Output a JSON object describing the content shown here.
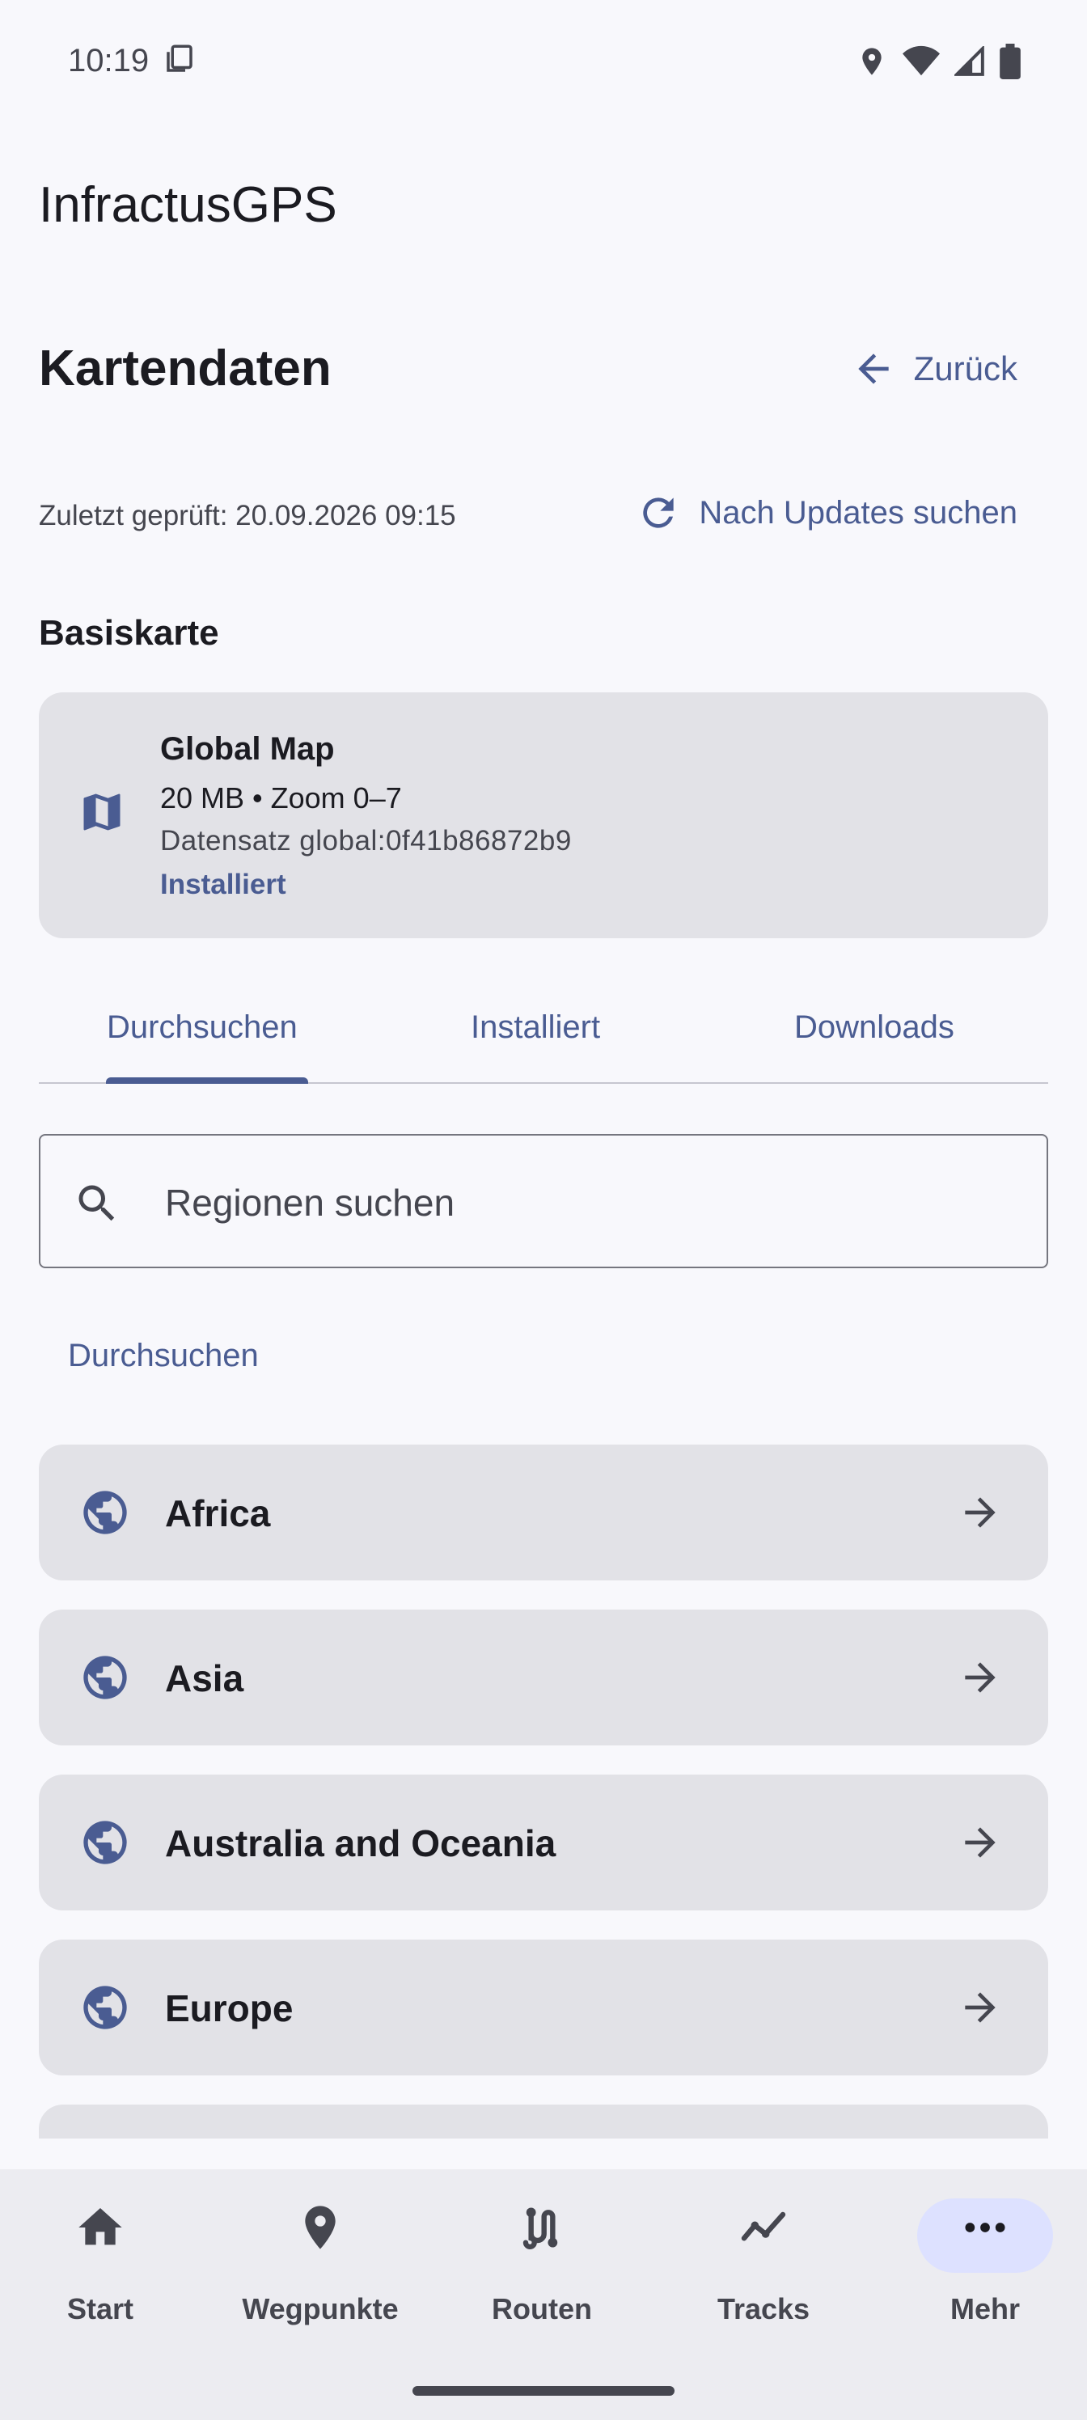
{
  "status_bar": {
    "time": "10:19"
  },
  "app": {
    "title": "InfractusGPS"
  },
  "header": {
    "title": "Kartendaten",
    "back_label": "Zurück"
  },
  "update": {
    "last_checked": "Zuletzt geprüft: 20.09.2026 09:15",
    "check_label": "Nach Updates suchen"
  },
  "base_map": {
    "section_label": "Basiskarte",
    "name": "Global Map",
    "details": "20 MB • Zoom 0–7",
    "dataset": "Datensatz global:0f41b86872b9",
    "status": "Installiert"
  },
  "tabs": [
    {
      "label": "Durchsuchen",
      "selected": true
    },
    {
      "label": "Installiert",
      "selected": false
    },
    {
      "label": "Downloads",
      "selected": false
    }
  ],
  "search": {
    "placeholder": "Regionen suchen",
    "value": ""
  },
  "browse": {
    "label": "Durchsuchen",
    "regions": [
      {
        "label": "Africa"
      },
      {
        "label": "Asia"
      },
      {
        "label": "Australia and Oceania"
      },
      {
        "label": "Europe"
      }
    ]
  },
  "bottom_nav": [
    {
      "label": "Start",
      "icon": "home-icon"
    },
    {
      "label": "Wegpunkte",
      "icon": "location-pin-icon"
    },
    {
      "label": "Routen",
      "icon": "route-icon"
    },
    {
      "label": "Tracks",
      "icon": "track-icon"
    },
    {
      "label": "Mehr",
      "icon": "more-icon",
      "selected": true
    }
  ],
  "colors": {
    "accent": "#4a5c92",
    "card": "#e2e2e7",
    "background": "#f8f8fc",
    "nav_pill": "#dde1ff"
  }
}
